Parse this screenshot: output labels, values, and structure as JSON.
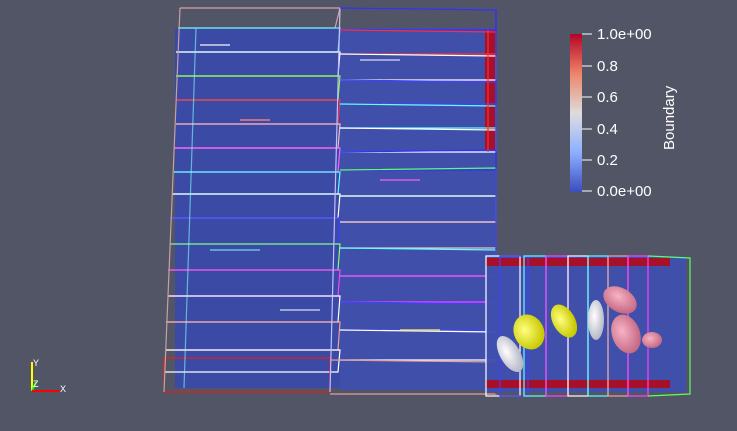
{
  "viewer": {
    "background": "#525566"
  },
  "colorbar": {
    "title": "Boundary",
    "colormap": "Cool to Warm",
    "range": [
      0.0,
      1.0
    ],
    "ticks": [
      "1.0e+00",
      "0.8",
      "0.6",
      "0.4",
      "0.2",
      "0.0e+00"
    ],
    "colors": {
      "high": "#b40426",
      "mid": "#dddddd",
      "low": "#3b4cc0"
    }
  },
  "axes": {
    "y_label": "Y",
    "z_label": "Z",
    "x_label": "X",
    "y_color": "#ffff00",
    "z_color": "#00ff00",
    "x_color": "#ff0000"
  }
}
